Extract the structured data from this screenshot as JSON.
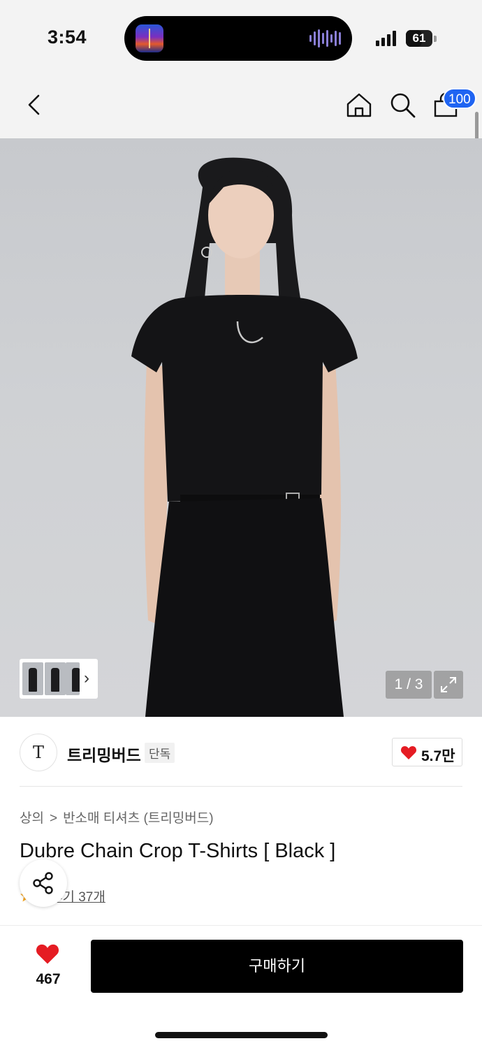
{
  "status_bar": {
    "time": "3:54",
    "battery": "61",
    "battery_level": 0.61
  },
  "nav": {
    "back_icon": "chevron-left-icon",
    "home_icon": "home-icon",
    "search_icon": "search-icon",
    "cart_icon": "shopping-bag-icon",
    "cart_badge": "100",
    "badge_color": "#1f64f2"
  },
  "gallery": {
    "counter": "1 / 3",
    "current_index": 1,
    "total": 3,
    "expand_icon": "expand-icon"
  },
  "brand": {
    "logo": "T",
    "name": "트리밍버드",
    "tag": "단독",
    "likes": "5.7만",
    "heart_color": "#e51c23"
  },
  "product": {
    "breadcrumb": [
      "상의",
      "반소매 티셔츠 (트리밍버드)"
    ],
    "breadcrumb_separator": ">",
    "title": "Dubre Chain Crop T-Shirts [ Black ]",
    "review_text": "후기 37개",
    "share_icon": "share-icon"
  },
  "bottom_bar": {
    "wish_count": "467",
    "buy_label": "구매하기"
  }
}
